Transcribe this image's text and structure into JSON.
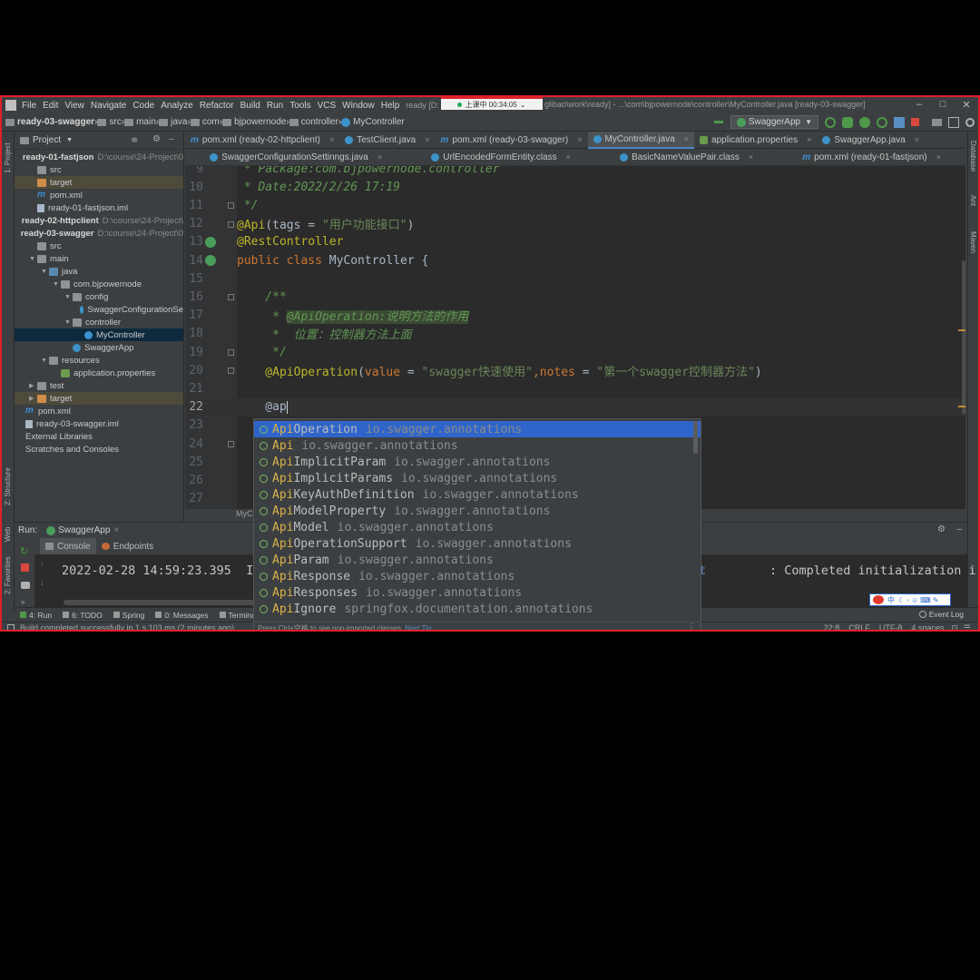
{
  "window": {
    "menu": [
      "File",
      "Edit",
      "View",
      "Navigate",
      "Code",
      "Analyze",
      "Refactor",
      "Build",
      "Run",
      "Tools",
      "VCS",
      "Window",
      "Help"
    ],
    "title_left": "ready [D:",
    "title_right": "glibao\\work\\ready] - ...\\com\\bjpowernode\\controller\\MyController.java [ready-03-swagger]",
    "overlay_label": "上课中 00:34:05",
    "controls": [
      "–",
      "□",
      "✕"
    ]
  },
  "breadcrumbs": [
    "ready-03-swagger",
    "src",
    "main",
    "java",
    "com",
    "bjpowernode",
    "controller",
    "MyController"
  ],
  "run_config": "SwaggerApp",
  "left_strip": [
    "1: Project",
    "Z: Structure",
    "Web",
    "2: Favorites"
  ],
  "right_strip": [
    "Database",
    "Ant",
    "Maven"
  ],
  "project": {
    "header": "Project",
    "tree": [
      {
        "label": "ready-01-fastjson",
        "extra": "D:\\course\\24-Project\\0",
        "indent": 0,
        "icon": "",
        "bold": true
      },
      {
        "label": "src",
        "indent": 1,
        "icon": "folder"
      },
      {
        "label": "target",
        "indent": 1,
        "icon": "folder-orange",
        "hl": true
      },
      {
        "label": "pom.xml",
        "indent": 1,
        "icon": "m"
      },
      {
        "label": "ready-01-fastjson.iml",
        "indent": 1,
        "icon": "file"
      },
      {
        "label": "ready-02-httpclient",
        "extra": "D:\\course\\24-Project\\",
        "indent": 0,
        "icon": "",
        "bold": true
      },
      {
        "label": "ready-03-swagger",
        "extra": "D:\\course\\24-Project\\0",
        "indent": 0,
        "icon": "",
        "bold": true
      },
      {
        "label": "src",
        "indent": 1,
        "icon": "folder"
      },
      {
        "label": "main",
        "indent": 1,
        "icon": "folder",
        "arrow": "▼"
      },
      {
        "label": "java",
        "indent": 2,
        "icon": "folder-blue",
        "arrow": "▼"
      },
      {
        "label": "com.bjpowernode",
        "indent": 3,
        "icon": "folder",
        "arrow": "▼"
      },
      {
        "label": "config",
        "indent": 4,
        "icon": "folder",
        "arrow": "▼"
      },
      {
        "label": "SwaggerConfigurationSe",
        "indent": 5,
        "icon": "class"
      },
      {
        "label": "controller",
        "indent": 4,
        "icon": "folder",
        "arrow": "▼"
      },
      {
        "label": "MyController",
        "indent": 5,
        "icon": "class",
        "selected": true
      },
      {
        "label": "SwaggerApp",
        "indent": 4,
        "icon": "class"
      },
      {
        "label": "resources",
        "indent": 2,
        "icon": "folder",
        "arrow": "▼"
      },
      {
        "label": "application.properties",
        "indent": 3,
        "icon": "props"
      },
      {
        "label": "test",
        "indent": 1,
        "icon": "folder",
        "arrow": "▶"
      },
      {
        "label": "target",
        "indent": 1,
        "icon": "folder-orange",
        "arrow": "▶",
        "hl": true
      },
      {
        "label": "pom.xml",
        "indent": 0,
        "icon": "m"
      },
      {
        "label": "ready-03-swagger.iml",
        "indent": 0,
        "icon": "file"
      },
      {
        "label": "External Libraries",
        "indent": 0,
        "icon": ""
      },
      {
        "label": "Scratches and Consoles",
        "indent": 0,
        "icon": ""
      }
    ]
  },
  "tabs_row1": [
    {
      "label": "pom.xml (ready-02-httpclient)",
      "icon": "m"
    },
    {
      "label": "TestClient.java",
      "icon": "c"
    },
    {
      "label": "pom.xml (ready-03-swagger)",
      "icon": "m"
    },
    {
      "label": "MyController.java",
      "icon": "c",
      "active": true
    },
    {
      "label": "application.properties",
      "icon": "p"
    },
    {
      "label": "SwaggerApp.java",
      "icon": "c"
    }
  ],
  "tabs_row2": [
    {
      "label": "SwaggerConfigurationSettinngs.java",
      "icon": "c"
    },
    {
      "label": "UrlEncodedFormEntity.class",
      "icon": "c"
    },
    {
      "label": "BasicNameValuePair.class",
      "icon": "c"
    },
    {
      "label": "pom.xml (ready-01-fastjson)",
      "icon": "m"
    }
  ],
  "code": {
    "line_numbers": [
      "9",
      "10",
      "11",
      "12",
      "13",
      "14",
      "15",
      "16",
      "17",
      "18",
      "19",
      "20",
      "21",
      "22",
      "23",
      "24",
      "25",
      "26",
      "27"
    ],
    "l9": " * Package:com.bjpowernode.controller",
    "l10": " * Date:2022/2/26 17:19",
    "l11": " */",
    "l12_ann": "@Api",
    "l12_a": "(tags = ",
    "l12_s": "\"用户功能接口\"",
    "l12_b": ")",
    "l13": "@RestController",
    "l14_kw": "public class ",
    "l14_cls": "MyController {",
    "l16": "    /**",
    "l17_a": "     * ",
    "l17_tag": "@ApiOperation:说明方法的作用",
    "l18": "     *  位置：控制器方法上面",
    "l19": "     */",
    "l20_ann": "    @ApiOperation",
    "l20_a": "(",
    "l20_p1": "value",
    "l20_b": " = ",
    "l20_s1": "\"swagger快速使用\"",
    "l20_c": ",",
    "l20_p2": "notes",
    "l20_d": " = ",
    "l20_s2": "\"第一个swagger控制器方法\"",
    "l20_e": ")",
    "l22": "    @ap",
    "crumb_bottom": "MyC"
  },
  "completion": {
    "typed_prefix": "Api",
    "items": [
      {
        "match": "Api",
        "rest": "Operation",
        "pkg": "io.swagger.annotations",
        "selected": true
      },
      {
        "match": "Api",
        "rest": "",
        "pkg": "io.swagger.annotations"
      },
      {
        "match": "Api",
        "rest": "ImplicitParam",
        "pkg": "io.swagger.annotations"
      },
      {
        "match": "Api",
        "rest": "ImplicitParams",
        "pkg": "io.swagger.annotations"
      },
      {
        "match": "Api",
        "rest": "KeyAuthDefinition",
        "pkg": "io.swagger.annotations"
      },
      {
        "match": "Api",
        "rest": "ModelProperty",
        "pkg": "io.swagger.annotations"
      },
      {
        "match": "Api",
        "rest": "Model",
        "pkg": "io.swagger.annotations"
      },
      {
        "match": "Api",
        "rest": "OperationSupport",
        "pkg": "io.swagger.annotations"
      },
      {
        "match": "Api",
        "rest": "Param",
        "pkg": "io.swagger.annotations"
      },
      {
        "match": "Api",
        "rest": "Response",
        "pkg": "io.swagger.annotations"
      },
      {
        "match": "Api",
        "rest": "Responses",
        "pkg": "io.swagger.annotations"
      },
      {
        "match": "Api",
        "rest": "Ignore",
        "pkg": "springfox.documentation.annotations"
      }
    ],
    "footer": "Press Ctrl+空格 to see non-imported classes",
    "tip": "Next Tip"
  },
  "run": {
    "label": "Run:",
    "config": "SwaggerApp",
    "tabs": [
      "Console",
      "Endpoints"
    ],
    "console_left": "2022-02-28 14:59:23.395  IN",
    "console_mid": "et",
    "console_right": ": Completed initialization i"
  },
  "bottom_tools": [
    "4: Run",
    "6: TODO",
    "Spring",
    "0: Messages",
    "Termina"
  ],
  "event_log": "Event Log",
  "ime_label": "中",
  "status": {
    "message": "Build completed successfully in 1 s 103 ms (2 minutes ago)",
    "position": "22:8",
    "line_sep": "CRLF",
    "encoding": "UTF-8",
    "indent": "4 spaces"
  },
  "colors": {
    "selection": "#2f65ca",
    "accent_border": "#e0202a",
    "tab_underline": "#4a88c7"
  }
}
